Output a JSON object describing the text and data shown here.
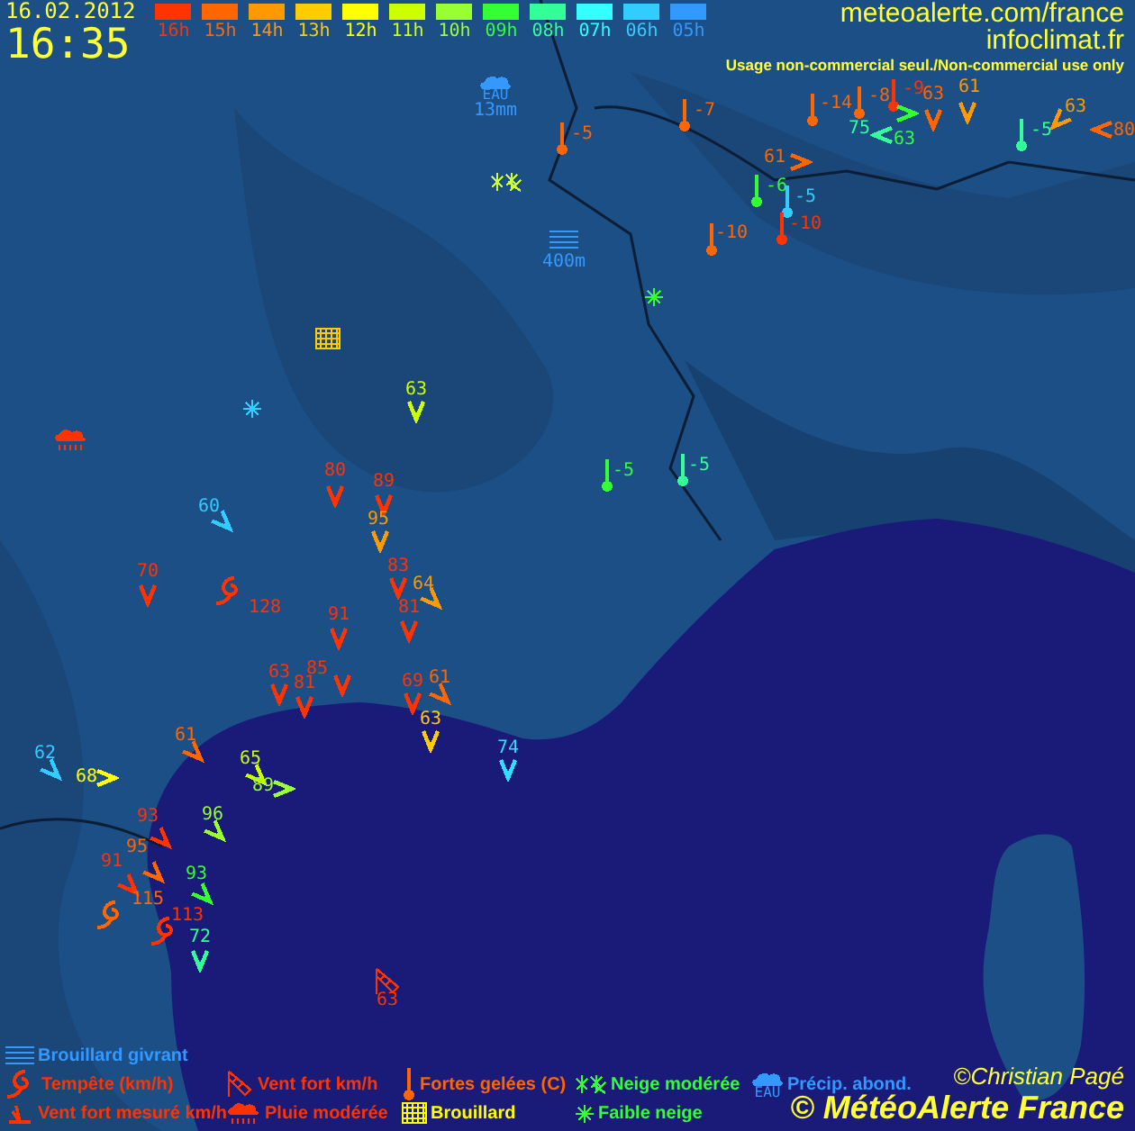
{
  "header": {
    "date": "16.02.2012",
    "time": "16:35",
    "site": "meteoalerte.com/france",
    "partner": "infoclimat.fr",
    "usage": "Usage non-commercial seul./Non-commercial use only"
  },
  "hour_scale": [
    {
      "label": "16h",
      "color": "#ff3300"
    },
    {
      "label": "15h",
      "color": "#ff6600"
    },
    {
      "label": "14h",
      "color": "#ff9900"
    },
    {
      "label": "13h",
      "color": "#ffcc00"
    },
    {
      "label": "12h",
      "color": "#ffff00"
    },
    {
      "label": "11h",
      "color": "#ccff00"
    },
    {
      "label": "10h",
      "color": "#99ff33"
    },
    {
      "label": "09h",
      "color": "#33ff33"
    },
    {
      "label": "08h",
      "color": "#33ff99"
    },
    {
      "label": "07h",
      "color": "#33ffff"
    },
    {
      "label": "06h",
      "color": "#33ccff"
    },
    {
      "label": "05h",
      "color": "#3399ff"
    }
  ],
  "markers": [
    {
      "kind": "precip",
      "badge": "EAU",
      "value": "13mm",
      "color": "#3399ff"
    },
    {
      "kind": "frost",
      "value": "-9",
      "color": "#ff3300"
    },
    {
      "kind": "frost",
      "value": "-7",
      "color": "#ff6600"
    },
    {
      "kind": "frost",
      "value": "-14",
      "color": "#ff6600"
    },
    {
      "kind": "frost",
      "value": "-8",
      "color": "#ff6600"
    },
    {
      "kind": "wind",
      "value": "63",
      "color": "#33ff33"
    },
    {
      "kind": "wind",
      "value": "63",
      "color": "#ff6600"
    },
    {
      "kind": "wind",
      "value": "61",
      "color": "#ff9900"
    },
    {
      "kind": "wind",
      "value": "63",
      "color": "#ff9900"
    },
    {
      "kind": "frost",
      "value": "-5",
      "color": "#ff6600"
    },
    {
      "kind": "wind",
      "value": "75",
      "color": "#33ff99"
    },
    {
      "kind": "frost",
      "value": "-5",
      "color": "#33ff99"
    },
    {
      "kind": "wind",
      "value": "80",
      "color": "#ff6600"
    },
    {
      "kind": "wind",
      "value": "61",
      "color": "#ff6600"
    },
    {
      "kind": "snow_moderate",
      "color": "#ccff33"
    },
    {
      "kind": "frost",
      "value": "-6",
      "color": "#33ff33"
    },
    {
      "kind": "frost",
      "value": "-5",
      "color": "#33ccff"
    },
    {
      "kind": "freezing_fog",
      "value": "400m",
      "color": "#3399ff"
    },
    {
      "kind": "frost",
      "value": "-10",
      "color": "#ff6600"
    },
    {
      "kind": "frost",
      "value": "-10",
      "color": "#ff3300"
    },
    {
      "kind": "snow_light",
      "color": "#33ff33"
    },
    {
      "kind": "fog",
      "color": "#ffcc00"
    },
    {
      "kind": "snow_light",
      "color": "#33ccff"
    },
    {
      "kind": "wind",
      "value": "63",
      "color": "#ccff00"
    },
    {
      "kind": "rain",
      "color": "#ff3300"
    },
    {
      "kind": "wind",
      "value": "80",
      "color": "#ff3300"
    },
    {
      "kind": "wind",
      "value": "89",
      "color": "#ff3300"
    },
    {
      "kind": "frost",
      "value": "-5",
      "color": "#33ff33"
    },
    {
      "kind": "frost",
      "value": "-5",
      "color": "#33ff99"
    },
    {
      "kind": "wind",
      "value": "60",
      "color": "#33ccff"
    },
    {
      "kind": "wind",
      "value": "95",
      "color": "#ff9900"
    },
    {
      "kind": "wind",
      "value": "70",
      "color": "#ff3300"
    },
    {
      "kind": "storm",
      "value": "128",
      "color": "#ff3300"
    },
    {
      "kind": "wind",
      "value": "83",
      "color": "#ff3300"
    },
    {
      "kind": "wind",
      "value": "64",
      "color": "#ff9900"
    },
    {
      "kind": "wind",
      "value": "91",
      "color": "#ff3300"
    },
    {
      "kind": "wind",
      "value": "81",
      "color": "#ff3300"
    },
    {
      "kind": "wind",
      "value": "63",
      "color": "#ff3300"
    },
    {
      "kind": "wind",
      "value": "81",
      "color": "#ff3300"
    },
    {
      "kind": "wind",
      "value": "85",
      "color": "#ff3300"
    },
    {
      "kind": "wind",
      "value": "69",
      "color": "#ff3300"
    },
    {
      "kind": "wind",
      "value": "61",
      "color": "#ff6600"
    },
    {
      "kind": "wind",
      "value": "63",
      "color": "#ffcc00"
    },
    {
      "kind": "wind",
      "value": "62",
      "color": "#33ccff"
    },
    {
      "kind": "wind",
      "value": "68",
      "color": "#ffff00"
    },
    {
      "kind": "wind",
      "value": "61",
      "color": "#ff6600"
    },
    {
      "kind": "wind",
      "value": "65",
      "color": "#ccff00"
    },
    {
      "kind": "wind",
      "value": "89",
      "color": "#99ff33"
    },
    {
      "kind": "wind",
      "value": "74",
      "color": "#33ddff"
    },
    {
      "kind": "wind",
      "value": "93",
      "color": "#ff3300"
    },
    {
      "kind": "wind",
      "value": "96",
      "color": "#99ff33"
    },
    {
      "kind": "wind",
      "value": "91",
      "color": "#ff3300"
    },
    {
      "kind": "wind",
      "value": "95",
      "color": "#ff6600"
    },
    {
      "kind": "wind",
      "value": "93",
      "color": "#33ff33"
    },
    {
      "kind": "storm",
      "value": "115",
      "color": "#ff6600"
    },
    {
      "kind": "storm",
      "value": "113",
      "color": "#ff3300"
    },
    {
      "kind": "wind",
      "value": "72",
      "color": "#33ff99"
    },
    {
      "kind": "windsock",
      "value": "63",
      "color": "#ff3300"
    }
  ],
  "legend": [
    {
      "kind": "freezing_fog",
      "label": "Brouillard givrant",
      "color": "#3399ff"
    },
    {
      "kind": "storm",
      "label": "Tempête (km/h)",
      "color": "#ff3300"
    },
    {
      "kind": "windsock",
      "label": "Vent fort km/h",
      "color": "#ff3300"
    },
    {
      "kind": "frost",
      "label": "Fortes gelées (C)",
      "color": "#ff6600"
    },
    {
      "kind": "snow_moderate",
      "label": "Neige modérée",
      "color": "#33ff33"
    },
    {
      "kind": "precip",
      "badge": "EAU",
      "label": "Précip. abond.",
      "color": "#3399ff"
    },
    {
      "kind": "wind_measured",
      "label": "Vent fort mesuré km/h",
      "color": "#ff3300"
    },
    {
      "kind": "rain",
      "label": "Pluie modérée",
      "color": "#ff3300"
    },
    {
      "kind": "fog",
      "label": "Brouillard",
      "color": "#ffff00"
    },
    {
      "kind": "snow_light",
      "label": "Faible neige",
      "color": "#33ff33"
    }
  ],
  "credits": {
    "author": "©Christian Pagé",
    "brand": "© MétéoAlerte France"
  }
}
